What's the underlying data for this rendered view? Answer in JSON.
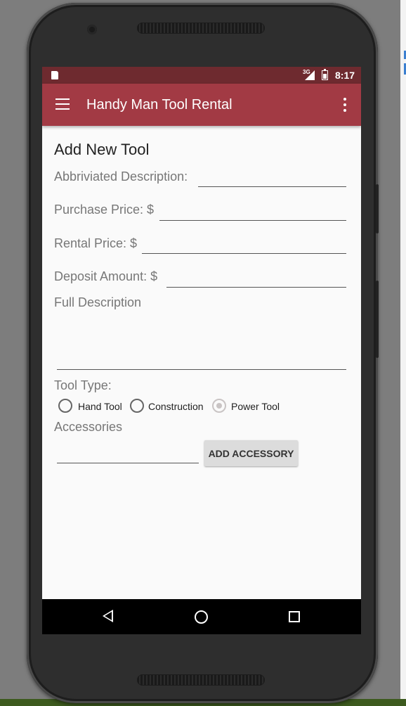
{
  "status_bar": {
    "network": "3G",
    "time": "8:17"
  },
  "app_bar": {
    "title": "Handy Man Tool Rental",
    "menu_icon": "hamburger-menu-icon",
    "overflow_icon": "more-vert-icon"
  },
  "form": {
    "heading": "Add New Tool",
    "abbreviated_description_label": "Abbriviated Description:",
    "abbreviated_description_value": "",
    "purchase_price_label": "Purchase Price: $",
    "purchase_price_value": "",
    "rental_price_label": "Rental Price: $",
    "rental_price_value": "",
    "deposit_amount_label": "Deposit Amount: $",
    "deposit_amount_value": "",
    "full_description_label": "Full Description",
    "full_description_value": "",
    "tool_type_label": "Tool Type:",
    "tool_types": [
      {
        "label": "Hand Tool",
        "selected": false
      },
      {
        "label": "Construction",
        "selected": false
      },
      {
        "label": "Power Tool",
        "selected": true
      }
    ],
    "accessories_label": "Accessories",
    "accessory_value": "",
    "add_accessory_button": "ADD ACCESSORY"
  },
  "nav_bar": {
    "back_icon": "back-triangle-icon",
    "home_icon": "home-circle-icon",
    "recents_icon": "recents-square-icon"
  },
  "colors": {
    "status_bar": "#6e2a2f",
    "app_bar": "#a23a44",
    "screen_background": "#fafafa",
    "radio_selected": "#c9c4c4"
  }
}
